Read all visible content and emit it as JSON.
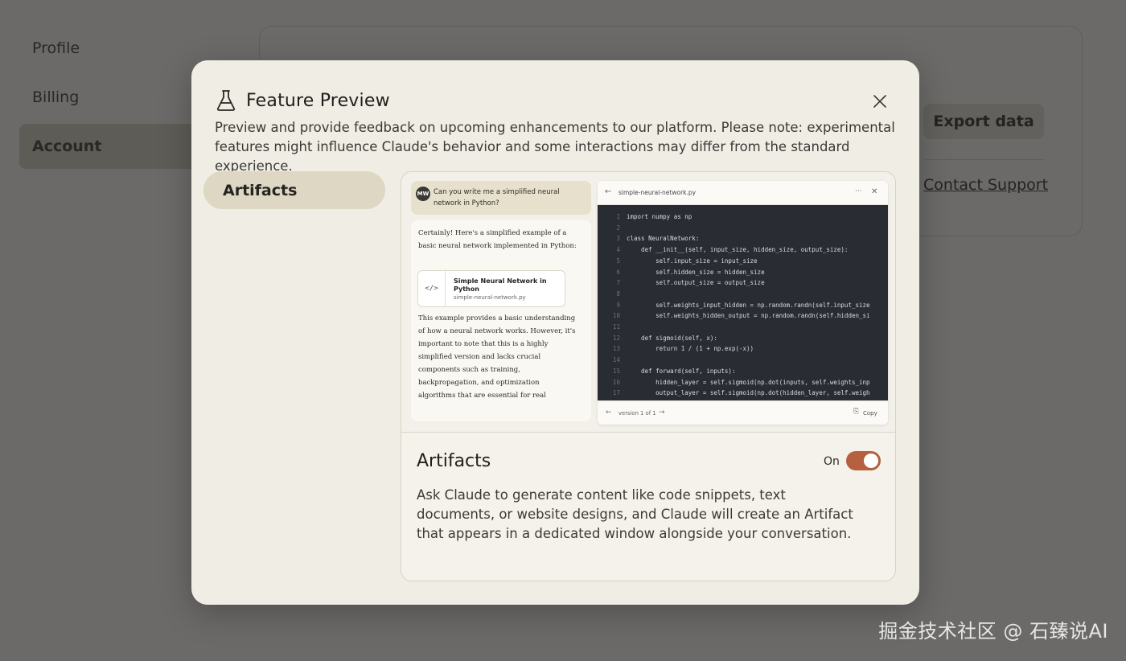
{
  "background": {
    "nav_items": [
      {
        "label": "Profile",
        "active": false
      },
      {
        "label": "Billing",
        "active": false
      },
      {
        "label": "Account",
        "active": true
      }
    ],
    "export_button": "Export data",
    "support_link": "Contact Support"
  },
  "modal": {
    "icon": "flask-icon",
    "title": "Feature Preview",
    "description": "Preview and provide feedback on upcoming enhancements to our platform. Please note: experimental features might influence Claude's behavior and some interactions may differ from the standard experience.",
    "tabs": [
      {
        "label": "Artifacts",
        "active": true
      }
    ],
    "feature": {
      "name": "Artifacts",
      "toggle_label": "On",
      "toggle_on": true,
      "description": "Ask Claude to generate content like code snippets, text documents, or website designs, and Claude will create an Artifact that appears in a dedicated window alongside your conversation."
    },
    "preview": {
      "avatar": "MW",
      "question": "Can you write me a simplified neural network in Python?",
      "answer_intro": "Certainly! Here's a simplified example of a basic neural network implemented in Python:",
      "artifact_icon": "</>",
      "artifact_title": "Simple Neural Network in Python",
      "artifact_file": "simple-neural-network.py",
      "answer_rest": "This example provides a basic understanding of how a neural network works. However, it's important to note that this is a highly simplified version and lacks crucial components such as training, backpropagation, and optimization algorithms that are essential for real",
      "code_filename": "simple-neural-network.py",
      "version_label": "version 1 of 1",
      "copy_label": "Copy",
      "code_lines": [
        {
          "n": "1",
          "text": "import numpy as np"
        },
        {
          "n": "2",
          "text": ""
        },
        {
          "n": "3",
          "text": "class NeuralNetwork:"
        },
        {
          "n": "4",
          "text": "    def __init__(self, input_size, hidden_size, output_size):"
        },
        {
          "n": "5",
          "text": "        self.input_size = input_size"
        },
        {
          "n": "6",
          "text": "        self.hidden_size = hidden_size"
        },
        {
          "n": "7",
          "text": "        self.output_size = output_size"
        },
        {
          "n": "8",
          "text": ""
        },
        {
          "n": "9",
          "text": "        self.weights_input_hidden = np.random.randn(self.input_size"
        },
        {
          "n": "10",
          "text": "        self.weights_hidden_output = np.random.randn(self.hidden_si"
        },
        {
          "n": "11",
          "text": ""
        },
        {
          "n": "12",
          "text": "    def sigmoid(self, x):"
        },
        {
          "n": "13",
          "text": "        return 1 / (1 + np.exp(-x))"
        },
        {
          "n": "14",
          "text": ""
        },
        {
          "n": "15",
          "text": "    def forward(self, inputs):"
        },
        {
          "n": "16",
          "text": "        hidden_layer = self.sigmoid(np.dot(inputs, self.weights_inp"
        },
        {
          "n": "17",
          "text": "        output_layer = self.sigmoid(np.dot(hidden_layer, self.weigh"
        }
      ]
    }
  },
  "watermark": "掘金技术社区 @ 石臻说AI",
  "colors": {
    "overlay": "#6b6a68",
    "modal_bg": "#efede4",
    "tab_active": "#ddd7c3",
    "toggle_on": "#b5603f",
    "code_bg": "#2a2c33"
  }
}
